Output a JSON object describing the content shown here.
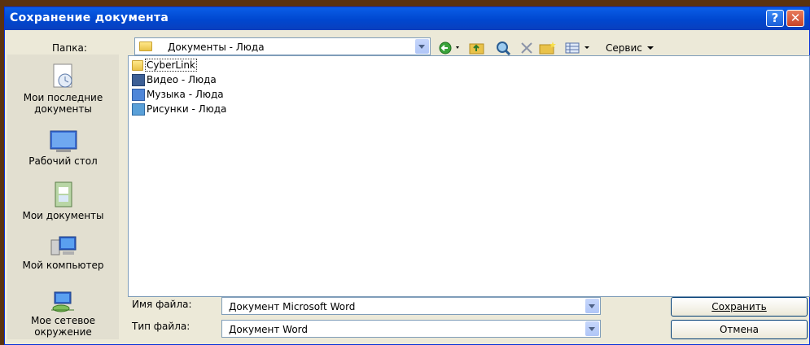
{
  "window": {
    "title": "Сохранение документа",
    "help_label": "?",
    "close_label": "✕"
  },
  "toolbar": {
    "folder_label": "Папка:",
    "folder_value": "Документы - Люда",
    "tools_label": "Сервис",
    "icons": [
      "back-icon",
      "up-folder-icon",
      "search-web-icon",
      "delete-icon",
      "new-folder-icon",
      "views-icon"
    ]
  },
  "places": [
    {
      "label": "Мои последние документы",
      "icon": "recent-documents-icon"
    },
    {
      "label": "Рабочий стол",
      "icon": "desktop-icon"
    },
    {
      "label": "Мои документы",
      "icon": "my-documents-icon"
    },
    {
      "label": "Мой компьютер",
      "icon": "my-computer-icon"
    },
    {
      "label": "Мое сетевое окружение",
      "icon": "network-places-icon"
    }
  ],
  "files": [
    {
      "name": "CyberLink",
      "icon": "folder-icon"
    },
    {
      "name": "Видео - Люда",
      "icon": "video-folder-icon"
    },
    {
      "name": "Музыка - Люда",
      "icon": "music-folder-icon"
    },
    {
      "name": "Рисунки - Люда",
      "icon": "pictures-folder-icon"
    }
  ],
  "form": {
    "filename_label": "Имя файла:",
    "filename_value": "Документ Microsoft Word",
    "filetype_label": "Тип файла:",
    "filetype_value": "Документ Word",
    "save_label": "Сохранить",
    "cancel_label": "Отмена"
  },
  "colors": {
    "title_bar": "#0054e3",
    "dialog_bg": "#ece9d8",
    "background": "#5a3210"
  }
}
